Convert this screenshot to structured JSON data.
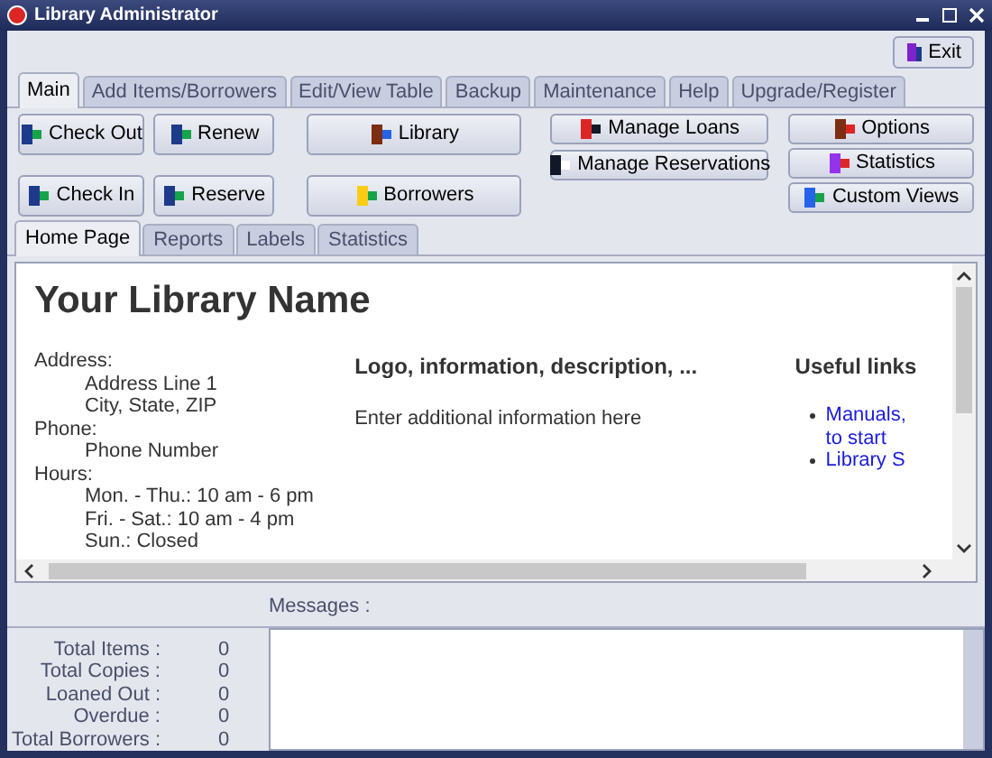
{
  "window": {
    "title": "Library Administrator"
  },
  "exit_button": "Exit",
  "main_tabs": [
    {
      "label": "Main",
      "selected": true
    },
    {
      "label": "Add Items/Borrowers",
      "selected": false
    },
    {
      "label": "Edit/View Table",
      "selected": false
    },
    {
      "label": "Backup",
      "selected": false
    },
    {
      "label": "Maintenance",
      "selected": false
    },
    {
      "label": "Help",
      "selected": false
    },
    {
      "label": "Upgrade/Register",
      "selected": false
    }
  ],
  "action_columns": [
    [
      "Check Out",
      "Check In"
    ],
    [
      "Renew",
      "Reserve"
    ],
    [
      "Library",
      "Borrowers"
    ],
    [
      "Manage Loans",
      "Manage Reservations"
    ],
    [
      "Options",
      "Statistics",
      "Custom Views"
    ]
  ],
  "sub_tabs": [
    {
      "label": "Home Page",
      "selected": true
    },
    {
      "label": "Reports",
      "selected": false
    },
    {
      "label": "Labels",
      "selected": false
    },
    {
      "label": "Statistics",
      "selected": false
    }
  ],
  "home_page": {
    "heading": "Your Library Name",
    "contact": [
      {
        "label": "Address:",
        "lines": [
          "Address Line 1",
          "City, State, ZIP"
        ]
      },
      {
        "label": "Phone:",
        "lines": [
          "Phone Number"
        ]
      },
      {
        "label": "Hours:",
        "lines": [
          "Mon. - Thu.: 10 am - 6 pm",
          "Fri. - Sat.: 10 am - 4 pm",
          "Sun.: Closed"
        ]
      }
    ],
    "info_heading": "Logo, information, description, ...",
    "info_text": "Enter additional information here",
    "links_heading": "Useful links",
    "links": [
      "Manuals, to start",
      "Library S"
    ]
  },
  "messages_label": "Messages :",
  "stats": [
    {
      "label": "Total Items :",
      "value": "0"
    },
    {
      "label": "Total Copies :",
      "value": "0"
    },
    {
      "label": "Loaned Out :",
      "value": "0"
    },
    {
      "label": "Overdue :",
      "value": "0"
    },
    {
      "label": "Total Borrowers :",
      "value": "0"
    }
  ]
}
